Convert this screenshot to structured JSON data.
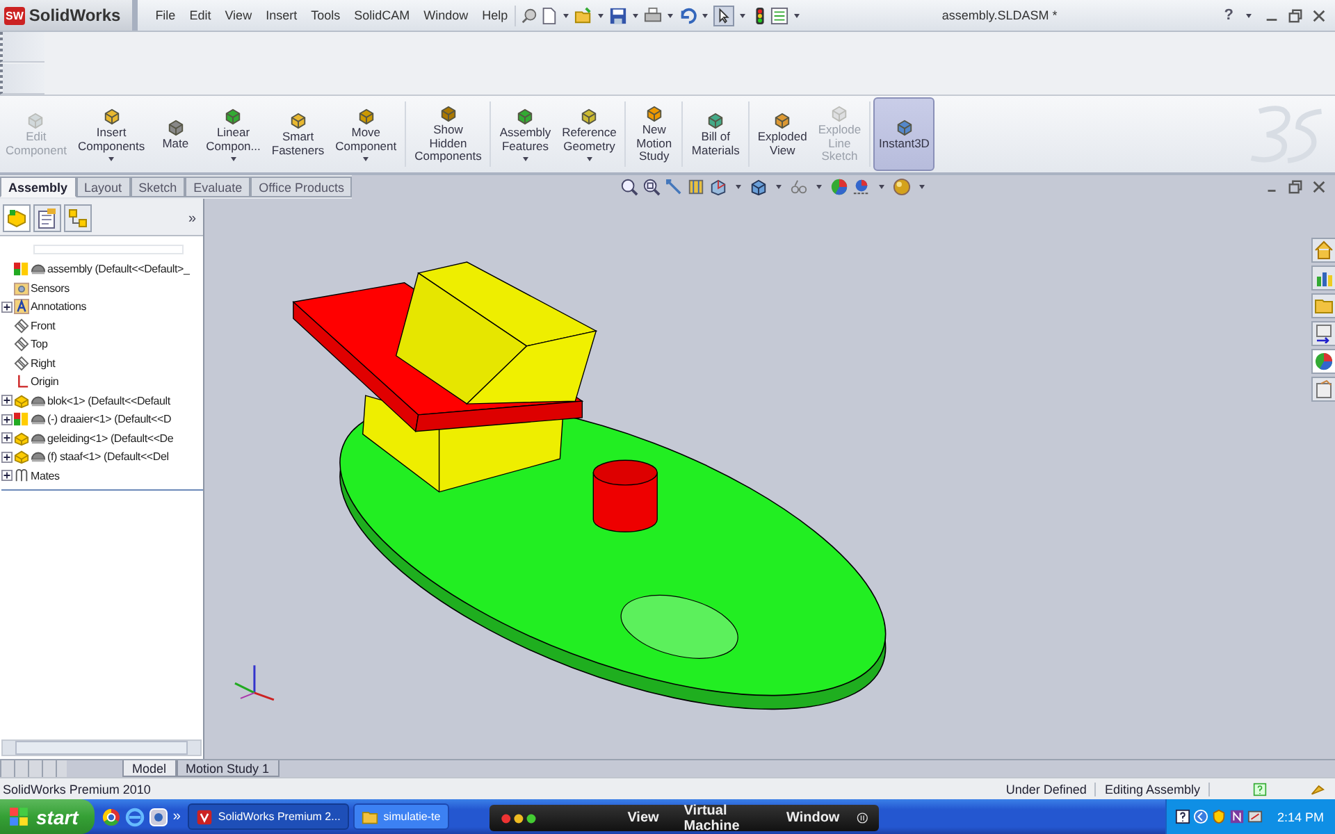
{
  "title_bar": {
    "logo_badge": "SW",
    "logo_text": "SolidWorks",
    "menu": [
      "File",
      "Edit",
      "View",
      "Insert",
      "Tools",
      "SolidCAM",
      "Window",
      "Help"
    ],
    "document_title": "assembly.SLDASM *",
    "help_label": "?"
  },
  "command_groups": [
    [
      {
        "label": "Edit\nComponent",
        "disabled": true,
        "dropdown": false,
        "selected": false
      },
      {
        "label": "Insert\nComponents",
        "disabled": false,
        "dropdown": true,
        "selected": false
      },
      {
        "label": "Mate",
        "disabled": false,
        "dropdown": false,
        "selected": false
      },
      {
        "label": "Linear\nCompon...",
        "disabled": false,
        "dropdown": true,
        "selected": false
      },
      {
        "label": "Smart\nFasteners",
        "disabled": false,
        "dropdown": false,
        "selected": false
      },
      {
        "label": "Move\nComponent",
        "disabled": false,
        "dropdown": true,
        "selected": false
      }
    ],
    [
      {
        "label": "Show\nHidden\nComponents",
        "disabled": false,
        "dropdown": false,
        "selected": false
      }
    ],
    [
      {
        "label": "Assembly\nFeatures",
        "disabled": false,
        "dropdown": true,
        "selected": false
      },
      {
        "label": "Reference\nGeometry",
        "disabled": false,
        "dropdown": true,
        "selected": false
      }
    ],
    [
      {
        "label": "New\nMotion\nStudy",
        "disabled": false,
        "dropdown": false,
        "selected": false
      }
    ],
    [
      {
        "label": "Bill of\nMaterials",
        "disabled": false,
        "dropdown": false,
        "selected": false
      }
    ],
    [
      {
        "label": "Exploded\nView",
        "disabled": false,
        "dropdown": false,
        "selected": false
      },
      {
        "label": "Explode\nLine\nSketch",
        "disabled": true,
        "dropdown": false,
        "selected": false
      }
    ],
    [
      {
        "label": "Instant3D",
        "disabled": false,
        "dropdown": false,
        "selected": true
      }
    ]
  ],
  "command_tabs": [
    {
      "label": "Assembly",
      "selected": true
    },
    {
      "label": "Layout",
      "selected": false
    },
    {
      "label": "Sketch",
      "selected": false
    },
    {
      "label": "Evaluate",
      "selected": false
    },
    {
      "label": "Office Products",
      "selected": false
    }
  ],
  "panel": {
    "more_label": "»",
    "tree": {
      "label": "assembly  (Default<<Default>_",
      "kind": "assembly",
      "collapsed": false,
      "children": [
        {
          "label": "Sensors",
          "kind": "sensors",
          "collapsed": false
        },
        {
          "label": "Annotations",
          "kind": "annotations",
          "collapsed": true
        },
        {
          "label": "Front",
          "kind": "plane",
          "collapsed": false
        },
        {
          "label": "Top",
          "kind": "plane",
          "collapsed": false
        },
        {
          "label": "Right",
          "kind": "plane",
          "collapsed": false
        },
        {
          "label": "Origin",
          "kind": "origin",
          "collapsed": false
        },
        {
          "label": "blok<1> (Default<<Default",
          "kind": "part",
          "collapsed": true
        },
        {
          "label": "(-) draaier<1> (Default<<D",
          "kind": "subassembly",
          "collapsed": true
        },
        {
          "label": "geleiding<1> (Default<<De",
          "kind": "part",
          "collapsed": true
        },
        {
          "label": "(f) staaf<1> (Default<<Del",
          "kind": "part",
          "collapsed": true
        },
        {
          "label": "Mates",
          "kind": "mates",
          "collapsed": true
        }
      ]
    }
  },
  "bottom_tabs": [
    {
      "label": "Model",
      "selected": true
    },
    {
      "label": "Motion Study 1",
      "selected": false
    }
  ],
  "status_bar": {
    "product": "SolidWorks Premium 2010",
    "state": "Under Defined",
    "mode": "Editing Assembly"
  },
  "taskbar": {
    "start": "start",
    "more": "»",
    "tasks": [
      {
        "label": "SolidWorks Premium 2...",
        "kind": "solidworks",
        "selected": true
      },
      {
        "label": "simulatie-te",
        "kind": "folder",
        "selected": false
      }
    ],
    "vm_menu": [
      "View",
      "Virtual Machine",
      "Window"
    ],
    "clock": "2:14 PM"
  }
}
